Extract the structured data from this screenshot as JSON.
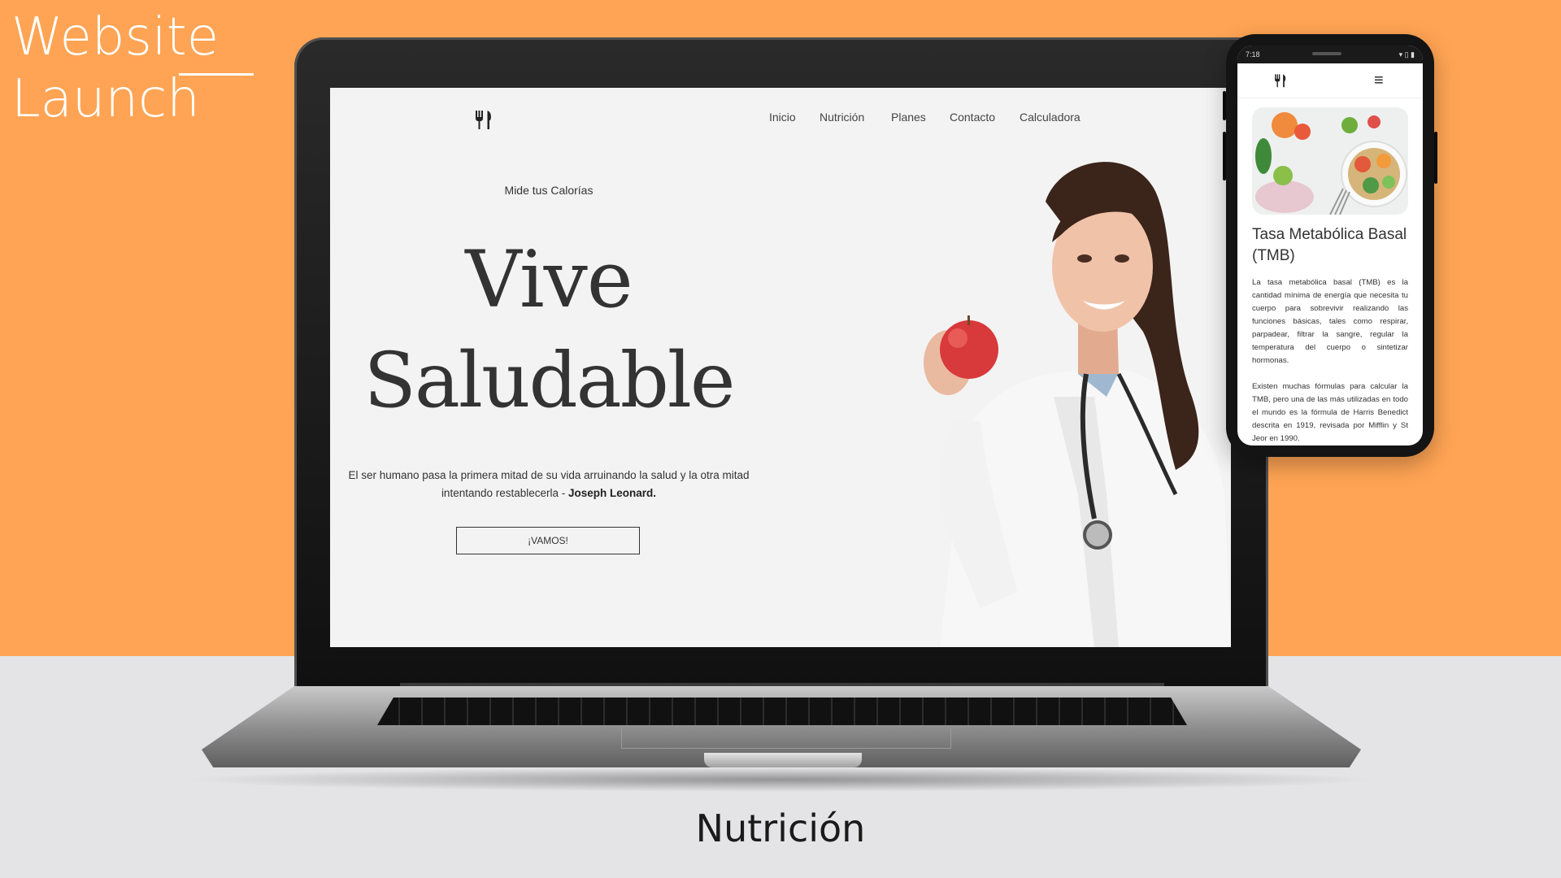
{
  "banner": {
    "title_line1": "Website",
    "title_line2": "Launch",
    "caption": "Nutrición"
  },
  "colors": {
    "background_orange": "#FFA454",
    "background_gray": "#E4E4E6",
    "site_background": "#F3F3F3",
    "text_dark": "#333333"
  },
  "site": {
    "logo_icon": "fork-knife-icon",
    "nav": [
      "Inicio",
      "Nutrición",
      "Planes",
      "Contacto",
      "Calculadora"
    ],
    "eyebrow": "Mide tus Calorías",
    "hero_line1": "Vive",
    "hero_line2": "Saludable",
    "quote_text": "El ser humano pasa la primera mitad de su vida arruinando la salud y la otra mitad intentando restablecerla - ",
    "quote_author": "Joseph Leonard.",
    "cta_label": "¡VAMOS!"
  },
  "phone": {
    "status_time": "7:18",
    "status_icons": "▾ ▯ ▮",
    "logo_icon": "fork-knife-icon",
    "menu_icon": "hamburger-menu-icon",
    "menu_glyph": "≡",
    "heading": "Tasa Metabólica Basal (TMB)",
    "paragraph1": "La tasa metabólica basal (TMB) es la cantidad mínima de energía que necesita tu cuerpo para sobrevivir realizando las funciones básicas, tales como respirar, parpadear, filtrar la sangre, regular la temperatura del cuerpo o sintetizar hormonas.",
    "paragraph2": "Existen muchas fórmulas para calcular la TMB, pero una de las más utilizadas en todo el mundo es la fórmula de Harris Benedict descrita en 1919, revisada por Mifflin y St Jeor en 1990."
  }
}
